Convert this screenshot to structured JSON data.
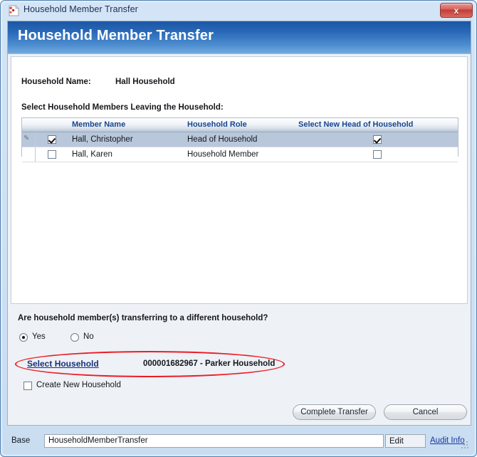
{
  "window": {
    "title": "Household Member Transfer",
    "icon": "app-document-icon",
    "close_label": "x"
  },
  "banner": {
    "title": "Household Member Transfer"
  },
  "form": {
    "household_name_label": "Household Name:",
    "household_name_value": "Hall Household",
    "select_members_label": "Select Household Members Leaving the Household:"
  },
  "grid": {
    "columns": [
      {
        "key": "leaving",
        "label": ""
      },
      {
        "key": "member_name",
        "label": "Member Name"
      },
      {
        "key": "household_role",
        "label": "Household Role"
      },
      {
        "key": "new_head",
        "label": "Select New Head of Household"
      }
    ],
    "rows": [
      {
        "selected": true,
        "leaving_checked": true,
        "member_name": "Hall, Christopher",
        "household_role": "Head of Household",
        "new_head_checked": true,
        "row_indicator": "edit-pencil-icon"
      },
      {
        "selected": false,
        "leaving_checked": false,
        "member_name": "Hall, Karen",
        "household_role": "Household Member",
        "new_head_checked": false,
        "row_indicator": ""
      }
    ]
  },
  "transfer": {
    "question": "Are household member(s) transferring to a different household?",
    "options": [
      {
        "label": "Yes",
        "selected": true
      },
      {
        "label": "No",
        "selected": false
      }
    ],
    "select_household_link": "Select Household",
    "selected_household": "000001682967 - Parker Household",
    "create_new_household_label": "Create New Household",
    "create_new_household_checked": false,
    "annotation_color": "#ec1c24"
  },
  "actions": {
    "complete_label": "Complete Transfer",
    "cancel_label": "Cancel"
  },
  "statusbar": {
    "base_label": "Base",
    "path_value": "HouseholdMemberTransfer",
    "edit_label": "Edit",
    "audit_label": "Audit Info"
  }
}
